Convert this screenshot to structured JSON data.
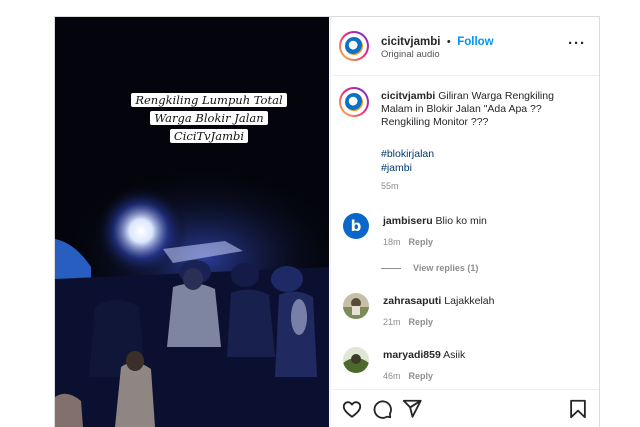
{
  "post": {
    "author": {
      "username": "cicitvjambi",
      "separator": "•",
      "follow_label": "Follow",
      "subtitle": "Original audio"
    },
    "more_label": "···",
    "overlay_text": [
      "Rengkiling Lumpuh Total",
      "Warga Blokir Jalan",
      "CiciTvJambi"
    ],
    "caption": {
      "username": "cicitvjambi",
      "text": "Giliran Warga Rengkiling Malam in Blokir Jalan \"Ada Apa ?? Rengkiling Monitor ???",
      "hashtags": [
        "#blokirjalan",
        "#jambi"
      ],
      "time": "55m"
    },
    "comments": [
      {
        "username": "jambiseru",
        "text": "Blio ko min",
        "time": "18m",
        "reply_label": "Reply",
        "view_replies": "View replies (1)",
        "avatar_icon": "jambiseru-logo-icon"
      },
      {
        "username": "zahrasaputi",
        "text": "Lajakkelah",
        "time": "21m",
        "reply_label": "Reply",
        "avatar_icon": "photo-avatar"
      },
      {
        "username": "maryadi859",
        "text": "Asiik",
        "time": "46m",
        "reply_label": "Reply",
        "avatar_icon": "photo-avatar"
      }
    ],
    "actions": {
      "like_icon": "heart-icon",
      "comment_icon": "comment-icon",
      "share_icon": "send-icon",
      "save_icon": "bookmark-icon"
    }
  },
  "colors": {
    "follow": "#0095f6",
    "hashtag": "#00376b",
    "muted": "#8e8e8e",
    "border": "#dbdbdb"
  }
}
